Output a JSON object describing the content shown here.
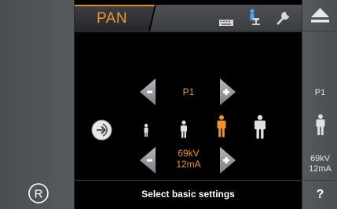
{
  "mode": {
    "label": "PAN"
  },
  "toolbar": {
    "icons": [
      "keyboard-icon",
      "patient-chair-icon",
      "wrench-icon"
    ]
  },
  "program": {
    "value": "P1"
  },
  "patient_sizes": {
    "options": [
      "small-child",
      "child",
      "adult-medium",
      "adult-large"
    ],
    "selected": "adult-medium"
  },
  "exposure": {
    "kv": "69kV",
    "ma": "12mA"
  },
  "status": {
    "message": "Select basic settings"
  },
  "right_panel": {
    "program": "P1",
    "kv": "69kV",
    "ma": "12mA",
    "help_label": "?"
  },
  "colors": {
    "accent": "#f0932a",
    "panel": "#52555a",
    "background": "#000000"
  }
}
